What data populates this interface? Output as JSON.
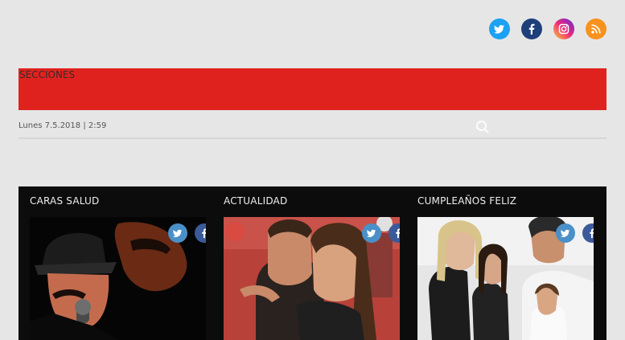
{
  "social": {
    "icons": [
      "twitter-icon",
      "facebook-icon",
      "instagram-icon",
      "rss-icon"
    ]
  },
  "header": {
    "sections_label": "SECCIONES",
    "bar_color": "#e0221f"
  },
  "datebar": {
    "date": "Lunes 7.5.2018 | 2:59"
  },
  "features": [
    {
      "title": "CARAS SALUD"
    },
    {
      "title": "ACTUALIDAD"
    },
    {
      "title": "CUMPLEAÑOS FELIZ"
    }
  ]
}
